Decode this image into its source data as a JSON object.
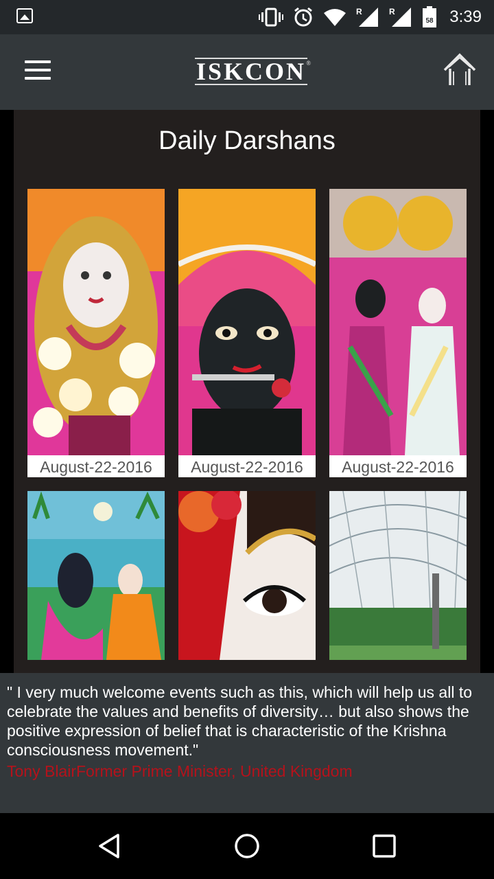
{
  "status_bar": {
    "time": "3:39",
    "battery_level": "58"
  },
  "app_bar": {
    "logo_text": "ISKCON",
    "logo_mark": "®"
  },
  "page": {
    "title": "Daily Darshans"
  },
  "darshans": [
    {
      "date": "August-22-2016",
      "image": "radha-deity-portrait"
    },
    {
      "date": "August-22-2016",
      "image": "krishna-deity-portrait"
    },
    {
      "date": "August-22-2016",
      "image": "radha-krishna-deities"
    },
    {
      "date": "",
      "image": "krishna-radha-painting"
    },
    {
      "date": "",
      "image": "deity-eye-closeup"
    },
    {
      "date": "",
      "image": "dome-structure-garden"
    }
  ],
  "quote": {
    "text": "\" I very much welcome events such as this, which will help us all to celebrate the values and benefits of diversity… but also shows the positive expression of belief that is characteristic of the Krishna consciousness movement.\"",
    "author": "Tony BlairFormer Prime Minister, United Kingdom"
  },
  "colors": {
    "app_bar": "#33383b",
    "content_bg": "#231f1e",
    "author": "#b5121b"
  }
}
